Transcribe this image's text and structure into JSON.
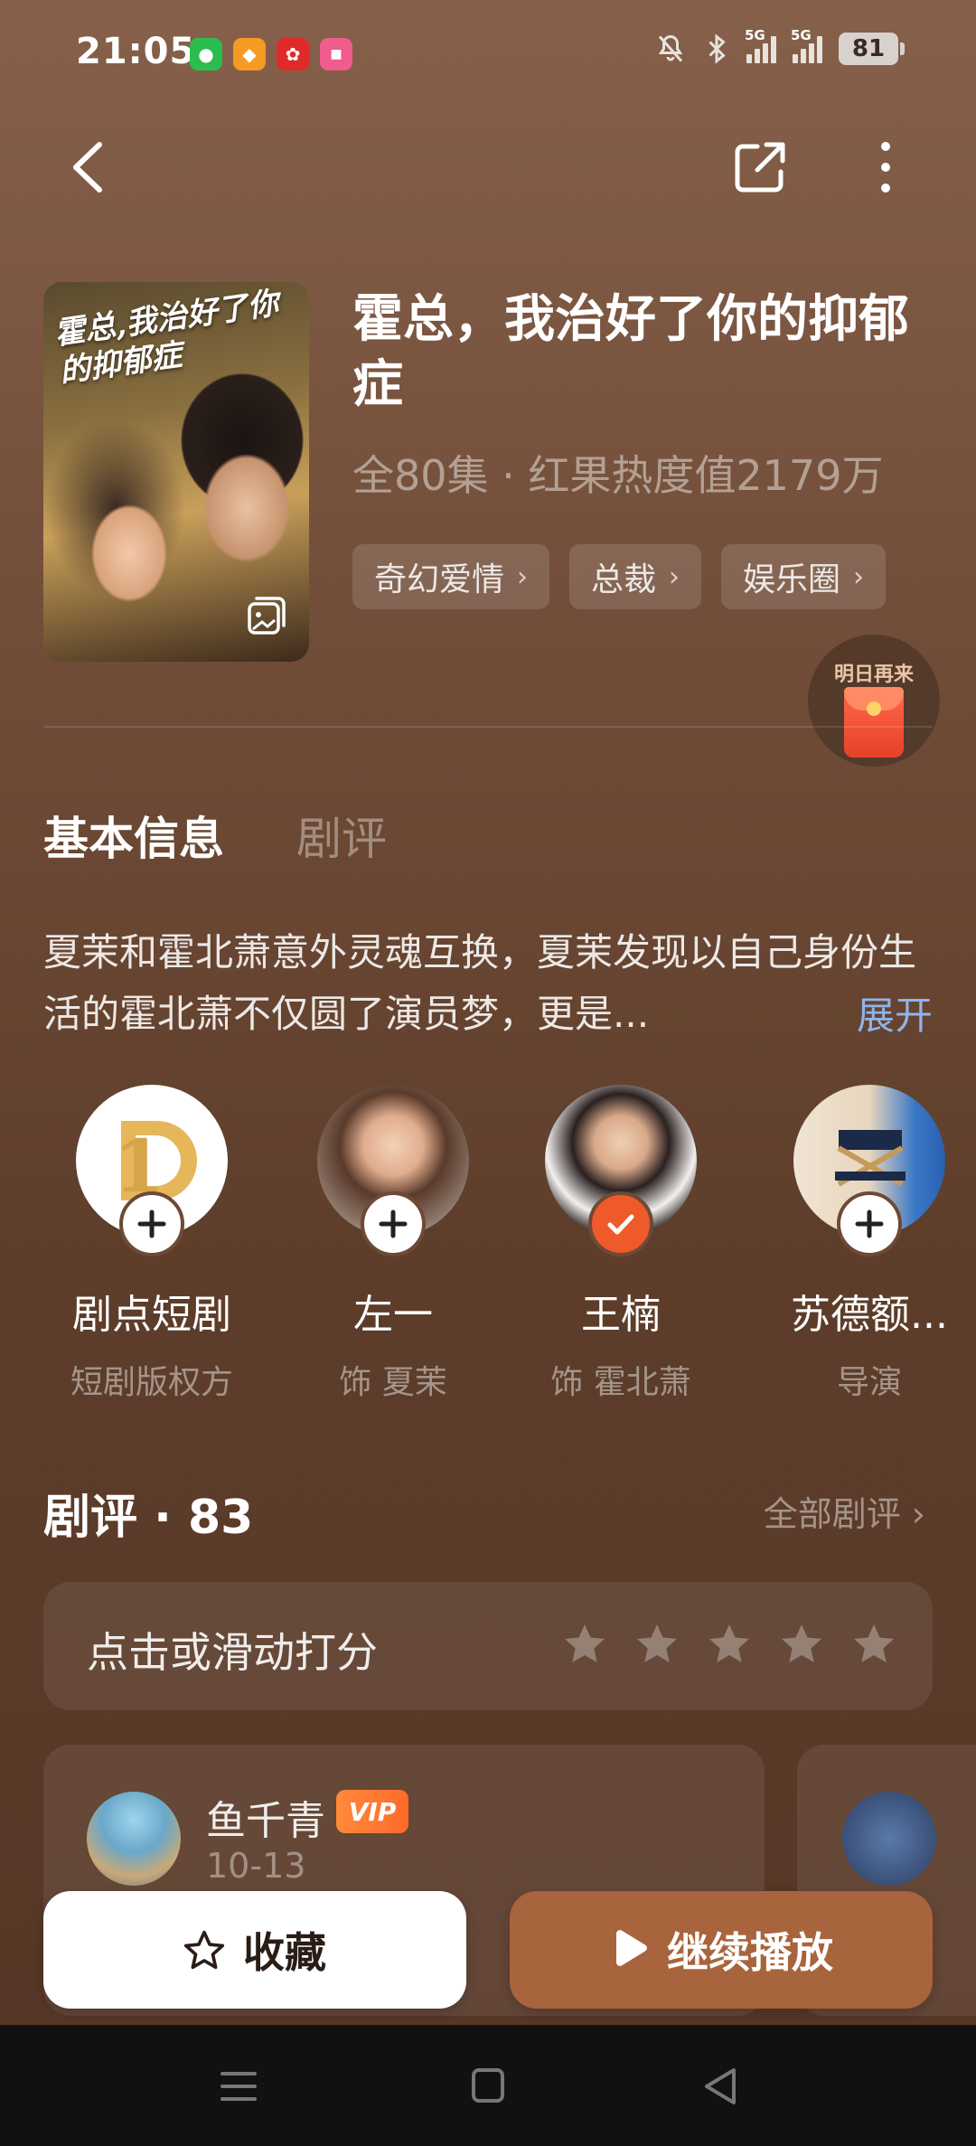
{
  "status_bar": {
    "time": "21:05",
    "apps": [
      "wechat-icon",
      "tool-icon",
      "gift-icon",
      "shop-icon"
    ],
    "signal1_label": "5G",
    "signal2_label": "5G",
    "battery": "81"
  },
  "show": {
    "poster_title": "霍总,我治好了你的抑郁症",
    "title": "霍总，我治好了你的抑郁症",
    "meta": "全80集 · 红果热度值2179万",
    "tags": [
      {
        "label": "奇幻爱情"
      },
      {
        "label": "总裁"
      },
      {
        "label": "娱乐圈"
      }
    ],
    "reward_label": "明日再来"
  },
  "tabs": {
    "basic": "基本信息",
    "review": "剧评"
  },
  "synopsis": {
    "text": "夏茉和霍北萧意外灵魂互换，夏茉发现以自己身份生活的霍北萧不仅圆了演员梦，更是...",
    "expand": "展开"
  },
  "cast": [
    {
      "name": "剧点短剧",
      "role": "短剧版权方",
      "followed": false
    },
    {
      "name": "左一",
      "role": "饰 夏茉",
      "followed": false
    },
    {
      "name": "王楠",
      "role": "饰 霍北萧",
      "followed": true
    },
    {
      "name": "苏德额...",
      "role": "导演",
      "followed": false
    }
  ],
  "reviews": {
    "heading": "剧评 · 83",
    "all_link": "全部剧评",
    "rate_label": "点击或滑动打分",
    "stars_selected": 0,
    "items": [
      {
        "user": "鱼千青",
        "vip": "VIP",
        "date": "10-13"
      }
    ]
  },
  "actions": {
    "favorite": "收藏",
    "continue": "继续播放"
  },
  "colors": {
    "accent_play": "#a8643c",
    "follow_check": "#ef5a2a",
    "expand_link": "#8fb4ea"
  }
}
